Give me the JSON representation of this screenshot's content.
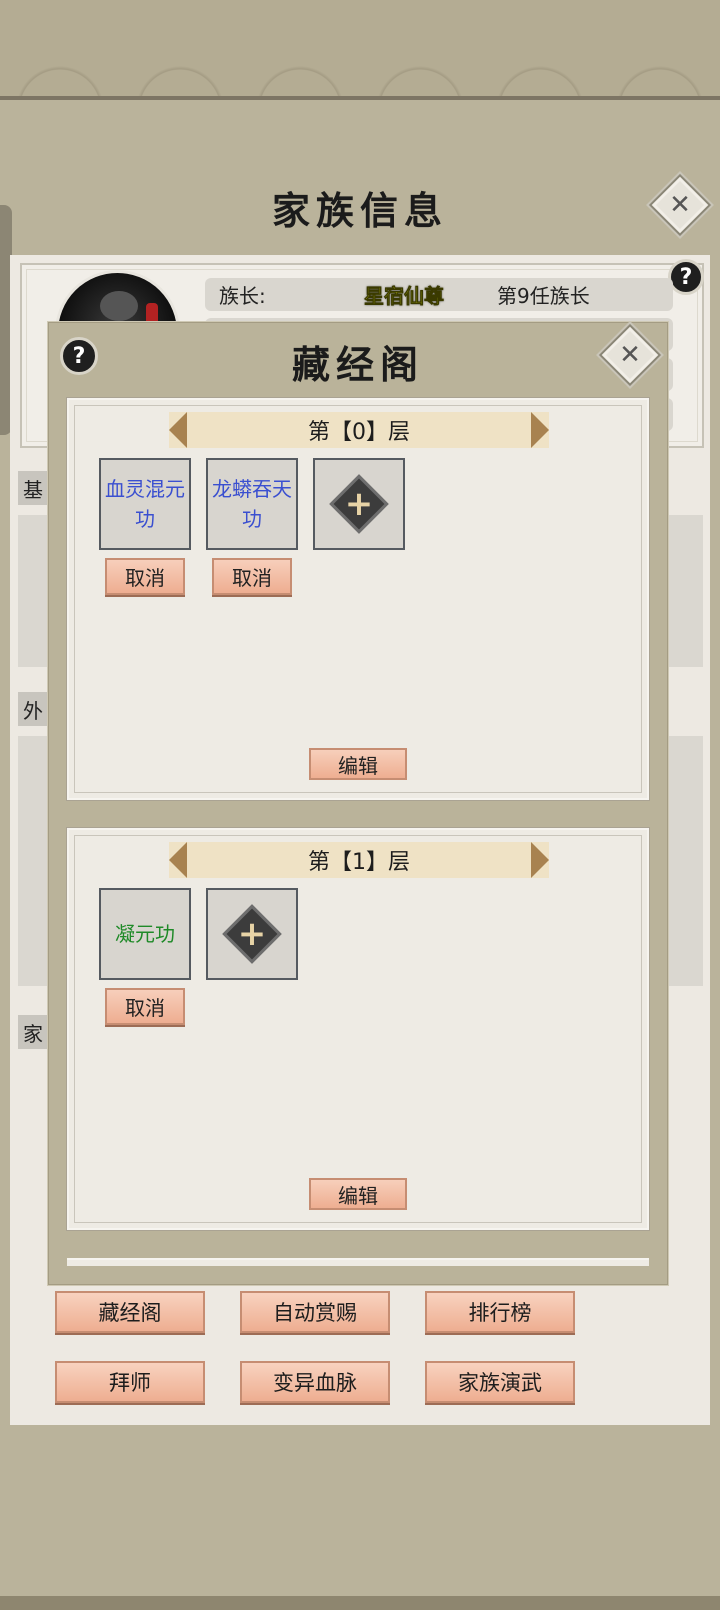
{
  "header": {
    "title": "家族信息"
  },
  "leader": {
    "label": "族长:",
    "name": "星宿仙尊",
    "rank": "第9任族长"
  },
  "side_tabs": [
    "基",
    "外",
    "家"
  ],
  "modal": {
    "title": "藏经阁",
    "floors": [
      {
        "banner": "第【0】层",
        "skills": [
          {
            "name": "血灵混元功",
            "color": "#3a4fd0"
          },
          {
            "name": "龙蟒吞天功",
            "color": "#3a4fd0"
          }
        ],
        "cancel_label": "取消",
        "edit_label": "编辑"
      },
      {
        "banner": "第【1】层",
        "skills": [
          {
            "name": "凝元功",
            "color": "#1f8a28"
          }
        ],
        "cancel_label": "取消",
        "edit_label": "编辑"
      }
    ]
  },
  "bottom_buttons": [
    "藏经阁",
    "自动赏赐",
    "排行榜",
    "拜师",
    "变异血脉",
    "家族演武"
  ],
  "icons": {
    "close": "close-icon",
    "help": "help-icon",
    "add": "add-skill-icon",
    "arrow_left": "arrow-left-icon",
    "arrow_right": "arrow-right-icon"
  }
}
